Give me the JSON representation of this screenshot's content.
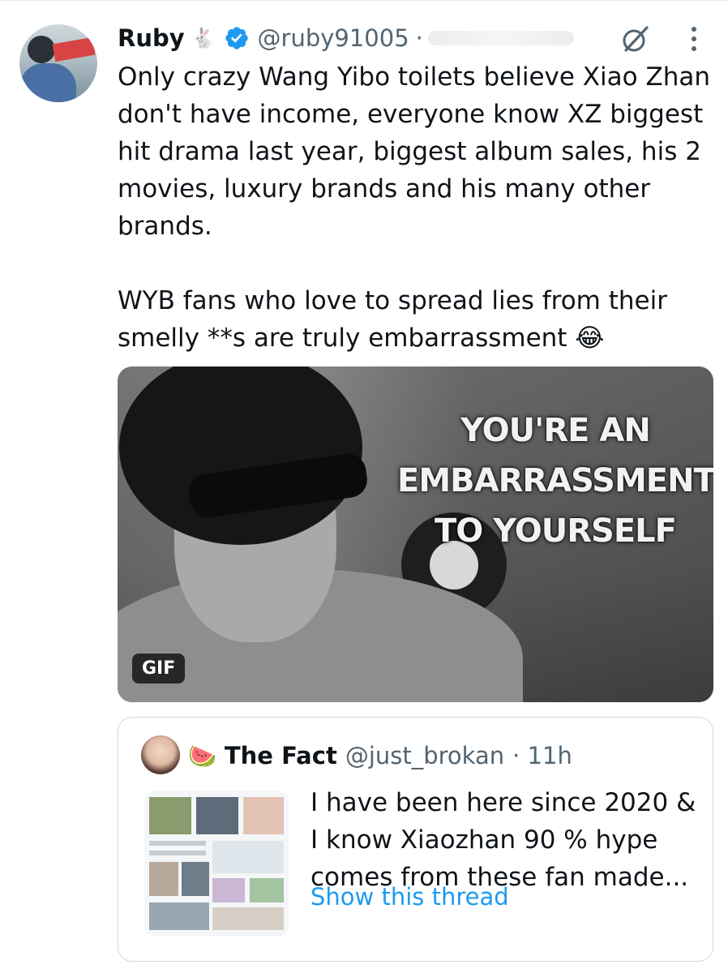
{
  "tweet": {
    "author_name": "Ruby",
    "author_emoji": "🐇",
    "handle": "@ruby91005",
    "separator": "·",
    "paragraphs": [
      "Only crazy Wang Yibo toilets believe Xiao Zhan don't have income, everyone know XZ biggest hit drama last year, biggest album sales, his 2 movies, luxury brands and his many other brands.",
      "WYB fans who love to spread lies from their smelly **s are truly embarrassment 😂"
    ]
  },
  "media": {
    "caption_lines": [
      "YOU'RE AN",
      "EMBARRASSMENT",
      "TO YOURSELF"
    ],
    "badge": "GIF"
  },
  "quote": {
    "emoji": "🍉",
    "author_name": "The Fact",
    "handle": "@just_brokan",
    "time": "· 11h",
    "text": "I have been here since 2020 & I know Xiaozhan 90 % hype comes from these fan made...",
    "link": "Show this thread"
  },
  "colors": {
    "text": "#0f1419",
    "muted": "#536471",
    "link": "#1d9bf0",
    "verified": "#1d9bf0",
    "border": "#cfd9de"
  },
  "icons": [
    "verified-badge-icon",
    "grok-icon",
    "more-options-icon"
  ]
}
